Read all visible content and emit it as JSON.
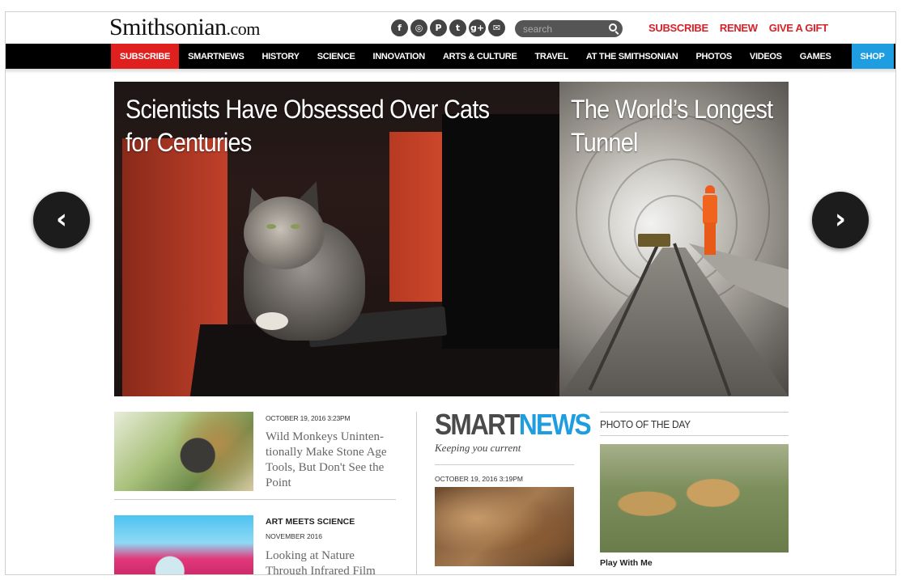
{
  "header": {
    "logo_main": "Smithsonian",
    "logo_suffix": ".com",
    "social_icons": [
      "facebook-icon",
      "instagram-icon",
      "pinterest-icon",
      "twitter-icon",
      "google-plus-icon",
      "email-icon"
    ],
    "social_glyphs": [
      "f",
      "◎",
      "P",
      "t",
      "g+",
      "✉"
    ],
    "search_placeholder": "search",
    "links": [
      "SUBSCRIBE",
      "RENEW",
      "GIVE A GIFT"
    ]
  },
  "nav": {
    "items": [
      "SUBSCRIBE",
      "SMARTNEWS",
      "HISTORY",
      "SCIENCE",
      "INNOVATION",
      "ARTS & CULTURE",
      "TRAVEL",
      "AT THE SMITHSONIAN",
      "PHOTOS",
      "VIDEOS",
      "GAMES",
      "SHOP"
    ]
  },
  "hero": {
    "slide1_title": "Scientists Have Obsessed Over Cats for Centuries",
    "slide2_title": "The World’s Longest Tunnel",
    "prev_glyph": "‹",
    "next_glyph": "›"
  },
  "stories": [
    {
      "date": "OCTOBER 19, 2016 3:23PM",
      "headline": "Wild Monkeys Uninten-tionally Make Stone Age Tools, But Don't See the Point"
    },
    {
      "kicker": "ART MEETS SCIENCE",
      "date": "NOVEMBER 2016",
      "headline": "Looking at Nature Through Infrared Film"
    }
  ],
  "smartnews": {
    "word1": "SMART",
    "word2": "NEWS",
    "tagline": "Keeping you current",
    "date": "OCTOBER 19, 2016 3:19PM"
  },
  "photo_of_day": {
    "title": "PHOTO OF THE DAY",
    "caption": "Play With Me"
  },
  "colors": {
    "accent_red": "#d62128",
    "accent_blue": "#1e9ee0",
    "nav_bg": "#000000"
  }
}
